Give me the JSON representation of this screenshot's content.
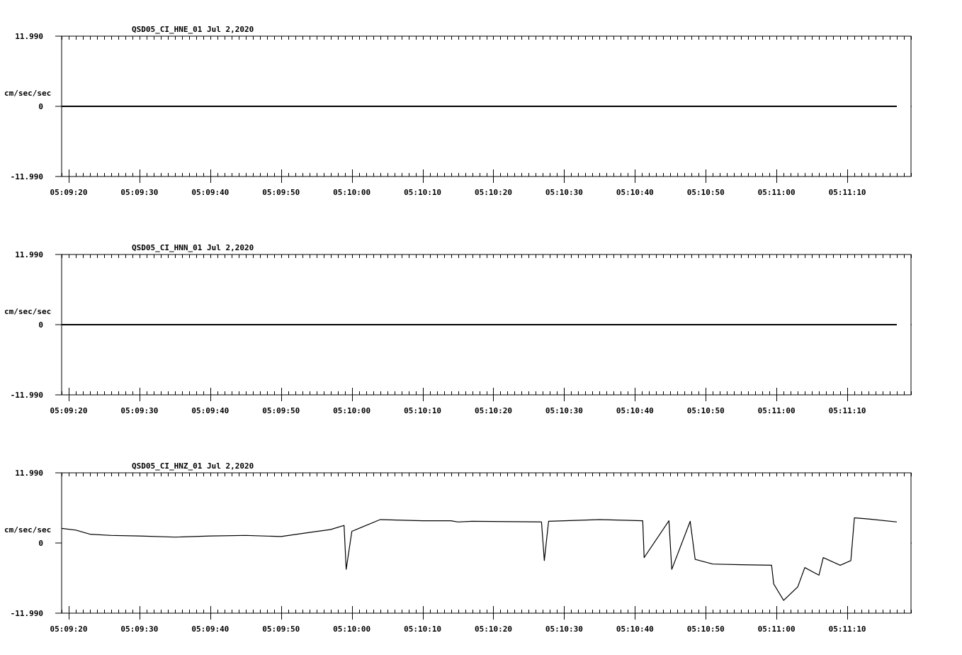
{
  "chart_data": [
    {
      "type": "line",
      "title": "QSD05_CI_HNE_01  Jul 2,2020",
      "ylabel": "cm/sec/sec",
      "ylim": [
        -11.99,
        11.99
      ],
      "ytick_labels": [
        "11.990",
        "0",
        "-11.990"
      ],
      "xlim_seconds": [
        -41,
        79
      ],
      "xtick_labels": [
        "05:09:20",
        "05:09:30",
        "05:09:40",
        "05:09:50",
        "05:10:00",
        "05:10:10",
        "05:10:20",
        "05:10:30",
        "05:10:40",
        "05:10:50",
        "05:11:00",
        "05:11:10"
      ],
      "x": [
        "05:09:19",
        "05:11:17"
      ],
      "y": [
        0,
        0
      ]
    },
    {
      "type": "line",
      "title": "QSD05_CI_HNN_01  Jul 2,2020",
      "ylabel": "cm/sec/sec",
      "ylim": [
        -11.99,
        11.99
      ],
      "ytick_labels": [
        "11.990",
        "0",
        "-11.990"
      ],
      "xlim_seconds": [
        -41,
        79
      ],
      "xtick_labels": [
        "05:09:20",
        "05:09:30",
        "05:09:40",
        "05:09:50",
        "05:10:00",
        "05:10:10",
        "05:10:20",
        "05:10:30",
        "05:10:40",
        "05:10:50",
        "05:11:00",
        "05:11:10"
      ],
      "x": [
        "05:09:19",
        "05:11:17"
      ],
      "y": [
        0,
        0
      ]
    },
    {
      "type": "line",
      "title": "QSD05_CI_HNZ_01  Jul 2,2020",
      "ylabel": "cm/sec/sec",
      "ylim": [
        -11.99,
        11.99
      ],
      "ytick_labels": [
        "11.990",
        "0",
        "-11.990"
      ],
      "xlim_seconds": [
        -41,
        79
      ],
      "xtick_labels": [
        "05:09:20",
        "05:09:30",
        "05:09:40",
        "05:09:50",
        "05:10:00",
        "05:10:10",
        "05:10:20",
        "05:10:30",
        "05:10:40",
        "05:10:50",
        "05:11:00",
        "05:11:10"
      ],
      "x": [
        "05:09:19",
        "05:09:21",
        "05:09:23",
        "05:09:26",
        "05:09:30",
        "05:09:35",
        "05:09:40",
        "05:09:45",
        "05:09:50",
        "05:09:54",
        "05:09:57",
        "05:09:58.9",
        "05:09:59.2",
        "05:10:00",
        "05:10:04",
        "05:10:10",
        "05:10:14",
        "05:10:15",
        "05:10:17",
        "05:10:26.8",
        "05:10:27.2",
        "05:10:27.8",
        "05:10:35",
        "05:10:41.1",
        "05:10:41.3",
        "05:10:44.8",
        "05:10:45.2",
        "05:10:47.8",
        "05:10:48.5",
        "05:10:51",
        "05:10:55",
        "05:10:59.3",
        "05:10:59.6",
        "05:11:01",
        "05:11:03",
        "05:11:04",
        "05:11:06",
        "05:11:06.6",
        "05:11:09",
        "05:11:10.5",
        "05:11:11",
        "05:11:13",
        "05:11:17"
      ],
      "y": [
        2.5,
        2.2,
        1.5,
        1.3,
        1.2,
        1.0,
        1.2,
        1.3,
        1.1,
        1.8,
        2.3,
        3.0,
        -4.5,
        2.0,
        4.0,
        3.8,
        3.8,
        3.6,
        3.7,
        3.6,
        -3.0,
        3.7,
        4.0,
        3.8,
        -2.5,
        3.8,
        -4.5,
        3.7,
        -2.8,
        -3.6,
        -3.7,
        -3.8,
        -7.0,
        -9.8,
        -7.5,
        -4.2,
        -5.5,
        -2.5,
        -3.8,
        -3.0,
        4.3,
        4.1,
        3.6
      ]
    }
  ]
}
